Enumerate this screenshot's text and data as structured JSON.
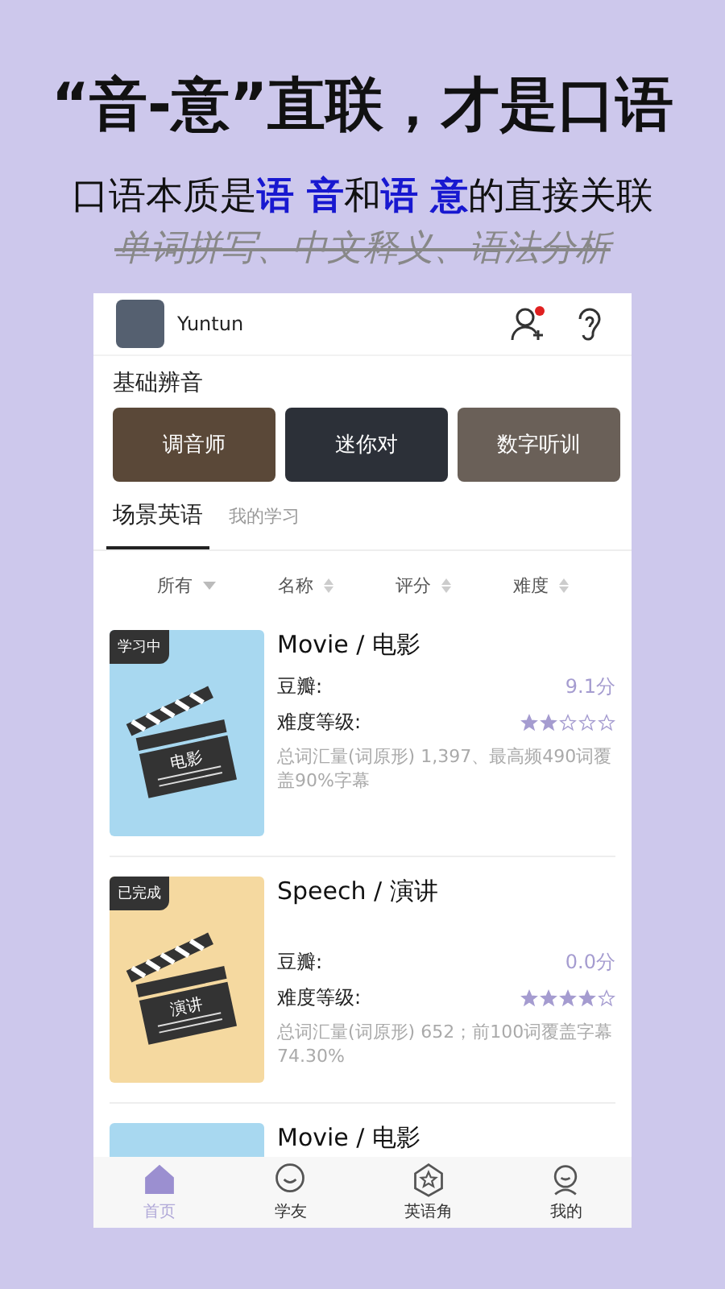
{
  "headline": "“音-意”直联，才是口语",
  "subtitle": "口语本质是**语 音**和**语 意**的直接关联",
  "struck_line": "单词拼写、中文释义、语法分析",
  "app": {
    "user": {
      "name": "Yuntun",
      "notification": true
    },
    "section_title": "基础辨音",
    "tiles": [
      {
        "label": "调音师",
        "color": "#5a4838"
      },
      {
        "label": "迷你对",
        "color": "#2c3038"
      },
      {
        "label": "数字听训",
        "color": "#6a6058"
      }
    ],
    "tabs": [
      {
        "label": "场景英语",
        "selected": true
      },
      {
        "label": "我的学习",
        "selected": false
      }
    ],
    "sorts": [
      {
        "label": "所有",
        "kind": "filter"
      },
      {
        "label": "名称",
        "kind": "sort"
      },
      {
        "label": "评分",
        "kind": "sort"
      },
      {
        "label": "难度",
        "kind": "sort"
      }
    ],
    "cards": [
      {
        "badge": "学习中",
        "thumb_label": "电影",
        "color": "#a8d8f0",
        "title": "Movie / 电影",
        "rating_label": "豆瓣:",
        "rating": "9.1分",
        "difficulty_label": "难度等级:",
        "stars": 2,
        "summary": "总词汇量(词原形) 1,397、最高频490词覆盖90%字幕"
      },
      {
        "badge": "已完成",
        "thumb_label": "演讲",
        "color": "#f5d9a0",
        "title": "Speech / 演讲",
        "rating_label": "豆瓣:",
        "rating": "0.0分",
        "difficulty_label": "难度等级:",
        "stars": 4,
        "summary": "总词汇量(词原形) 652；前100词覆盖字幕74.30%"
      },
      {
        "color": "#a8d8f0",
        "title": "Movie / 电影"
      }
    ],
    "nav": [
      {
        "label": "首页",
        "kind": "home",
        "selected": true
      },
      {
        "label": "学友",
        "kind": "chat",
        "selected": false
      },
      {
        "label": "英语角",
        "kind": "star",
        "selected": false
      },
      {
        "label": "我的",
        "kind": "profile",
        "selected": false
      }
    ]
  }
}
